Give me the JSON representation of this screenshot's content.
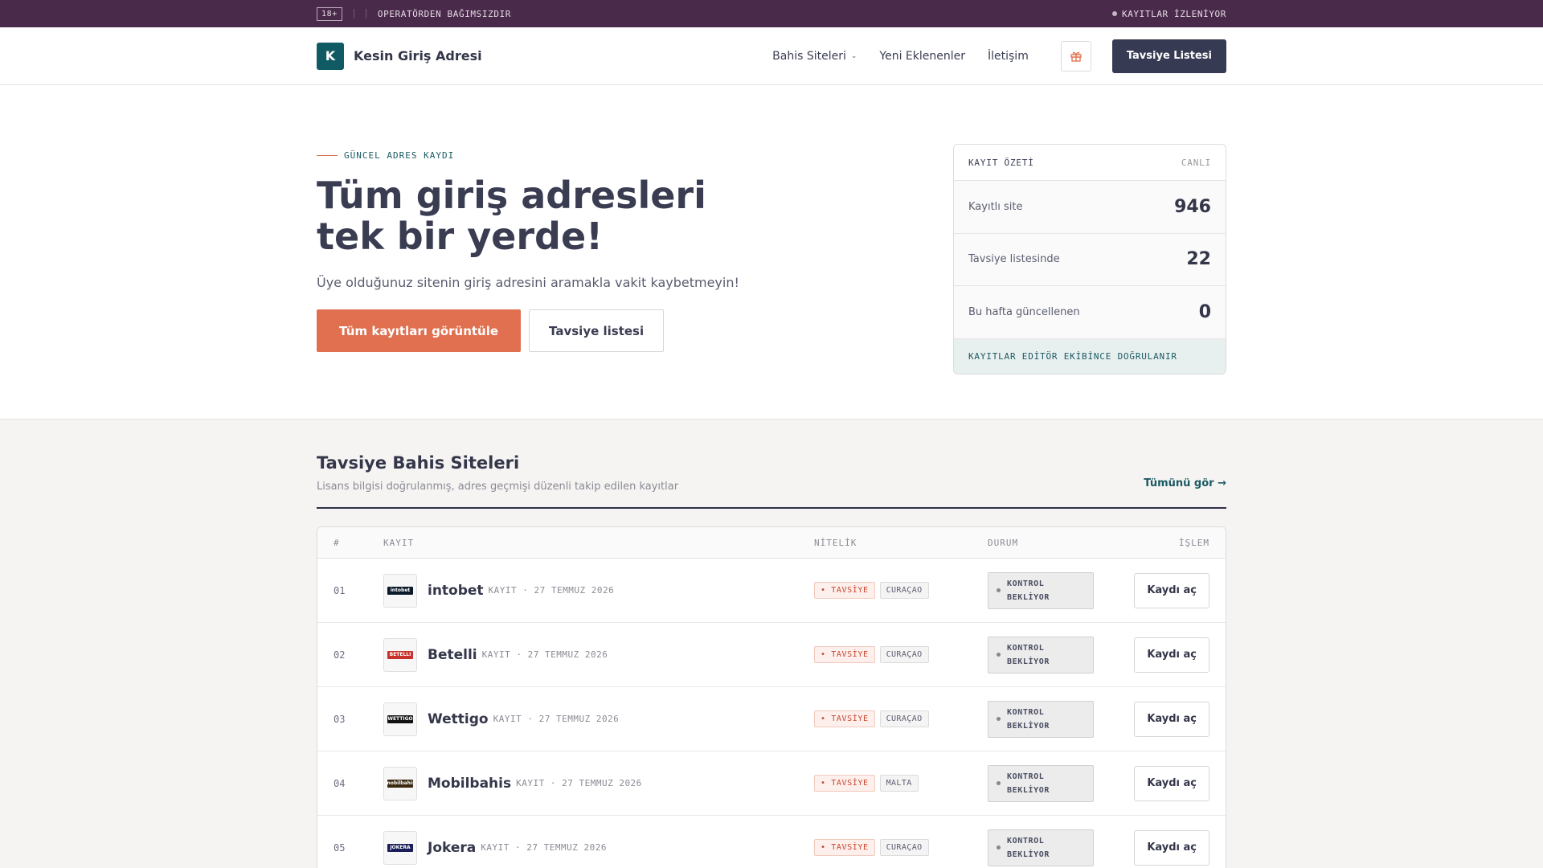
{
  "topbar": {
    "age_badge": "18+",
    "disclaimer": "OPERATÖRDEN BAĞIMSIZDIR",
    "status": "KAYITLAR İZLENİYOR"
  },
  "header": {
    "logo_letter": "K",
    "brand": "Kesin Giriş Adresi",
    "nav": [
      "Bahis Siteleri",
      "Yeni Eklenenler",
      "İletişim"
    ],
    "cta": "Tavsiye Listesi"
  },
  "hero": {
    "eyebrow": "GÜNCEL ADRES KAYDI",
    "title": "Tüm giriş adresleri tek bir yerde!",
    "subtitle": "Üye olduğunuz sitenin giriş adresini aramakla vakit kaybetmeyin!",
    "primary_button": "Tüm kayıtları görüntüle",
    "secondary_button": "Tavsiye listesi"
  },
  "summary": {
    "title": "KAYIT ÖZETİ",
    "badge": "CANLI",
    "rows": [
      {
        "label": "Kayıtlı site",
        "value": "946"
      },
      {
        "label": "Tavsiye listesinde",
        "value": "22"
      },
      {
        "label": "Bu hafta güncellenen",
        "value": "0"
      }
    ],
    "footer": "KAYITLAR EDİTÖR EKİBİNCE DOĞRULANIR"
  },
  "section": {
    "title": "Tavsiye Bahis Siteleri",
    "subtitle": "Lisans bilgisi doğrulanmış, adres geçmişi düzenli takip edilen kayıtlar",
    "see_all": "Tümünü gör →"
  },
  "table": {
    "headers": [
      "#",
      "KAYIT",
      "NİTELİK",
      "DURUM",
      "İŞLEM"
    ],
    "rows": [
      {
        "num": "01",
        "name": "intobet",
        "meta": "KAYIT · 27 TEMMUZ 2026",
        "tag": "TAVSİYE",
        "license": "CURAÇAO",
        "status_line1": "KONTROL",
        "status_line2": "BEKLİYOR",
        "action": "Kaydı aç",
        "logo_text": "intobet",
        "logo_color": "#0b1a2a"
      },
      {
        "num": "02",
        "name": "Betelli",
        "meta": "KAYIT · 27 TEMMUZ 2026",
        "tag": "TAVSİYE",
        "license": "CURAÇAO",
        "status_line1": "KONTROL",
        "status_line2": "BEKLİYOR",
        "action": "Kaydı aç",
        "logo_text": "BETELLI",
        "logo_color": "#c8322a"
      },
      {
        "num": "03",
        "name": "Wettigo",
        "meta": "KAYIT · 27 TEMMUZ 2026",
        "tag": "TAVSİYE",
        "license": "CURAÇAO",
        "status_line1": "KONTROL",
        "status_line2": "BEKLİYOR",
        "action": "Kaydı aç",
        "logo_text": "WETTIGO",
        "logo_color": "#111111"
      },
      {
        "num": "04",
        "name": "Mobilbahis",
        "meta": "KAYIT · 27 TEMMUZ 2026",
        "tag": "TAVSİYE",
        "license": "MALTA",
        "status_line1": "KONTROL",
        "status_line2": "BEKLİYOR",
        "action": "Kaydı aç",
        "logo_text": "mobilbahis",
        "logo_color": "#3a2a12"
      },
      {
        "num": "05",
        "name": "Jokera",
        "meta": "KAYIT · 27 TEMMUZ 2026",
        "tag": "TAVSİYE",
        "license": "CURAÇAO",
        "status_line1": "KONTROL",
        "status_line2": "BEKLİYOR",
        "action": "Kaydı aç",
        "logo_text": "JOKERA",
        "logo_color": "#1a1f5a"
      }
    ]
  },
  "colors": {
    "topbar": "#4a2a4a",
    "brand_teal": "#0f5a63",
    "accent_orange": "#e0704f",
    "dark_button": "#363a52"
  }
}
